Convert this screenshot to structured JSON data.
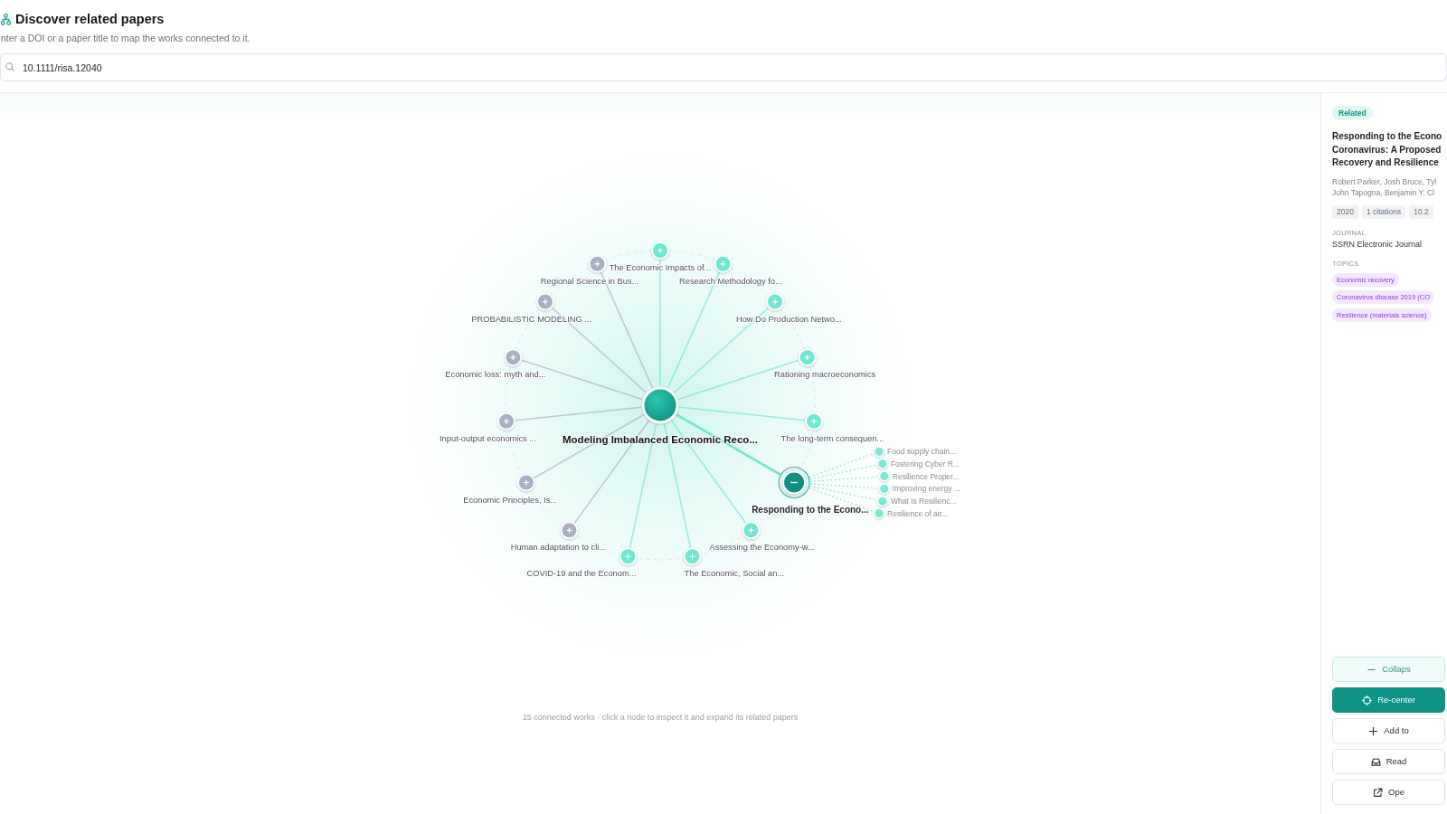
{
  "header": {
    "title": "Discover related papers",
    "subtitle": "nter a DOI or a paper title to map the works connected to it."
  },
  "search": {
    "value": "10.1111/risa.12040"
  },
  "graph": {
    "center": {
      "label": "Modeling Imbalanced Economic Reco..."
    },
    "nodes": [
      {
        "label": "The Economic Impacts of...",
        "color": "#6ee7d3",
        "selected": false,
        "expanded": false
      },
      {
        "label": "Regional Science in Bus...",
        "color": "#a9b0c3",
        "selected": false,
        "expanded": false
      },
      {
        "label": "Research Methodology fo...",
        "color": "#6ee7d3",
        "selected": false,
        "expanded": false
      },
      {
        "label": "PROBABILISTIC MODELING ...",
        "color": "#a9b0c3",
        "selected": false,
        "expanded": false
      },
      {
        "label": "How Do Production Netwo...",
        "color": "#6ee7d3",
        "selected": false,
        "expanded": false
      },
      {
        "label": "Economic loss: myth and...",
        "color": "#a9b0c3",
        "selected": false,
        "expanded": false
      },
      {
        "label": "Rationing macroeconomics",
        "color": "#6ee7d3",
        "selected": false,
        "expanded": false
      },
      {
        "label": "Input-output economics ...",
        "color": "#a9b0c3",
        "selected": false,
        "expanded": false
      },
      {
        "label": "The long-term consequen...",
        "color": "#6ee7d3",
        "selected": false,
        "expanded": false
      },
      {
        "label": "Economic Principles, Is...",
        "color": "#a9b0c3",
        "selected": false,
        "expanded": false
      },
      {
        "label": "Responding to the Econo...",
        "color": "#6ee7d3",
        "selected": true,
        "expanded": true,
        "children": [
          {
            "label": "Food supply chain..."
          },
          {
            "label": "Fostering Cyber R..."
          },
          {
            "label": "Resilience Proper..."
          },
          {
            "label": "Improving energy ..."
          },
          {
            "label": "What Is Resilienc..."
          },
          {
            "label": "Resilience of air..."
          }
        ]
      },
      {
        "label": "Human adaptation to cli...",
        "color": "#a9b0c3",
        "selected": false,
        "expanded": false
      },
      {
        "label": "Assessing the Economy-w...",
        "color": "#6ee7d3",
        "selected": false,
        "expanded": false
      },
      {
        "label": "COVID-19 and the Econom...",
        "color": "#6ee7d3",
        "selected": false,
        "expanded": false
      },
      {
        "label": "The Economic, Social an...",
        "color": "#6ee7d3",
        "selected": false,
        "expanded": false
      }
    ],
    "caption": "15 connected works · click a node to inspect it and expand its related papers"
  },
  "details": {
    "tag": "Related",
    "title_lines": [
      "Responding to the Econo",
      "Coronavirus: A Proposed",
      "Recovery and Resilience"
    ],
    "author_lines": [
      "Robert Parker, Josh Bruce, Tyl",
      "John Tapogna, Benjamin Y. Cl"
    ],
    "meta": [
      "2020",
      "1 citations",
      "10.2"
    ],
    "journal_heading": "JOURNAL",
    "journal": "SSRN Electronic Journal",
    "topics_heading": "TOPICS",
    "topics": [
      "Economic recovery",
      "Coronavirus disease 2019 (CO",
      "Resilience (materials science)"
    ],
    "actions": [
      {
        "kind": "collapse",
        "label": "Collaps"
      },
      {
        "kind": "recenter",
        "label": "Re-center"
      },
      {
        "kind": "add",
        "label": "Add to"
      },
      {
        "kind": "read",
        "label": "Read"
      },
      {
        "kind": "open",
        "label": "Ope"
      }
    ]
  }
}
